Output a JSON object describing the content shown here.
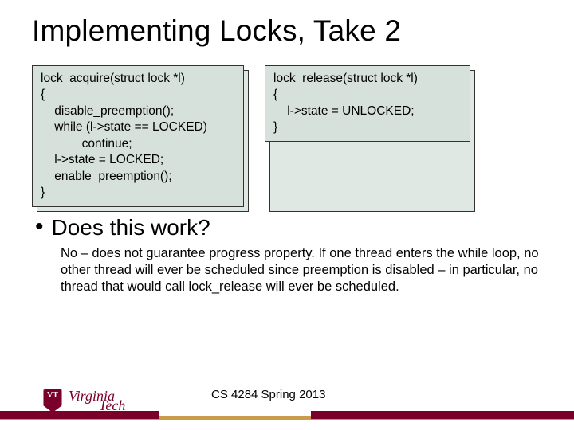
{
  "title": "Implementing Locks, Take 2",
  "code": {
    "acquire": "lock_acquire(struct lock *l)\n{\n    disable_preemption();\n    while (l->state == LOCKED)\n            continue;\n    l->state = LOCKED;\n    enable_preemption();\n}",
    "release": "lock_release(struct lock *l)\n{\n    l->state = UNLOCKED;\n}"
  },
  "bullet": "Does this work?",
  "explanation": "No – does not guarantee progress property. If one thread enters the while loop, no other thread will ever be scheduled since preemption is disabled – in particular, no thread that would call lock_release will ever be scheduled.",
  "footer": {
    "course": "CS 4284 Spring 2013",
    "institution1": "Virginia",
    "institution2": "Tech"
  }
}
